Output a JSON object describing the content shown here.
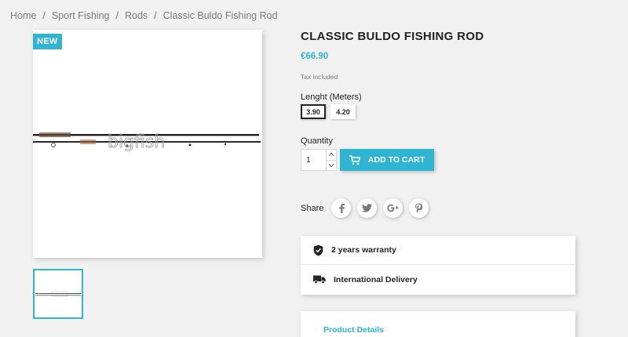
{
  "breadcrumb": {
    "items": [
      "Home",
      "Sport Fishing",
      "Rods",
      "Classic Buldo Fishing Rod"
    ],
    "separator": "/"
  },
  "product": {
    "badge": "NEW",
    "image_watermark": "bigfish",
    "title": "CLASSIC BULDO FISHING ROD",
    "price": "€66.90",
    "tax_note": "Tax included",
    "variant_label": "Lenght (Meters)",
    "variants": [
      "3.90",
      "4.20"
    ],
    "selected_variant": "3.90"
  },
  "cart": {
    "quantity_label": "Quantity",
    "quantity_value": "1",
    "add_to_cart_label": "ADD TO CART"
  },
  "share": {
    "label": "Share",
    "networks": [
      "facebook-icon",
      "twitter-icon",
      "google-plus-icon",
      "pinterest-icon"
    ]
  },
  "reassurance": {
    "items": [
      {
        "icon": "shield-check-icon",
        "text": "2 years warranty"
      },
      {
        "icon": "truck-icon",
        "text": "International Delivery"
      }
    ]
  },
  "tabs": {
    "product_details": "Product Details"
  },
  "colors": {
    "accent": "#2fb5d2",
    "background": "#f1f1f1",
    "text": "#232323"
  }
}
